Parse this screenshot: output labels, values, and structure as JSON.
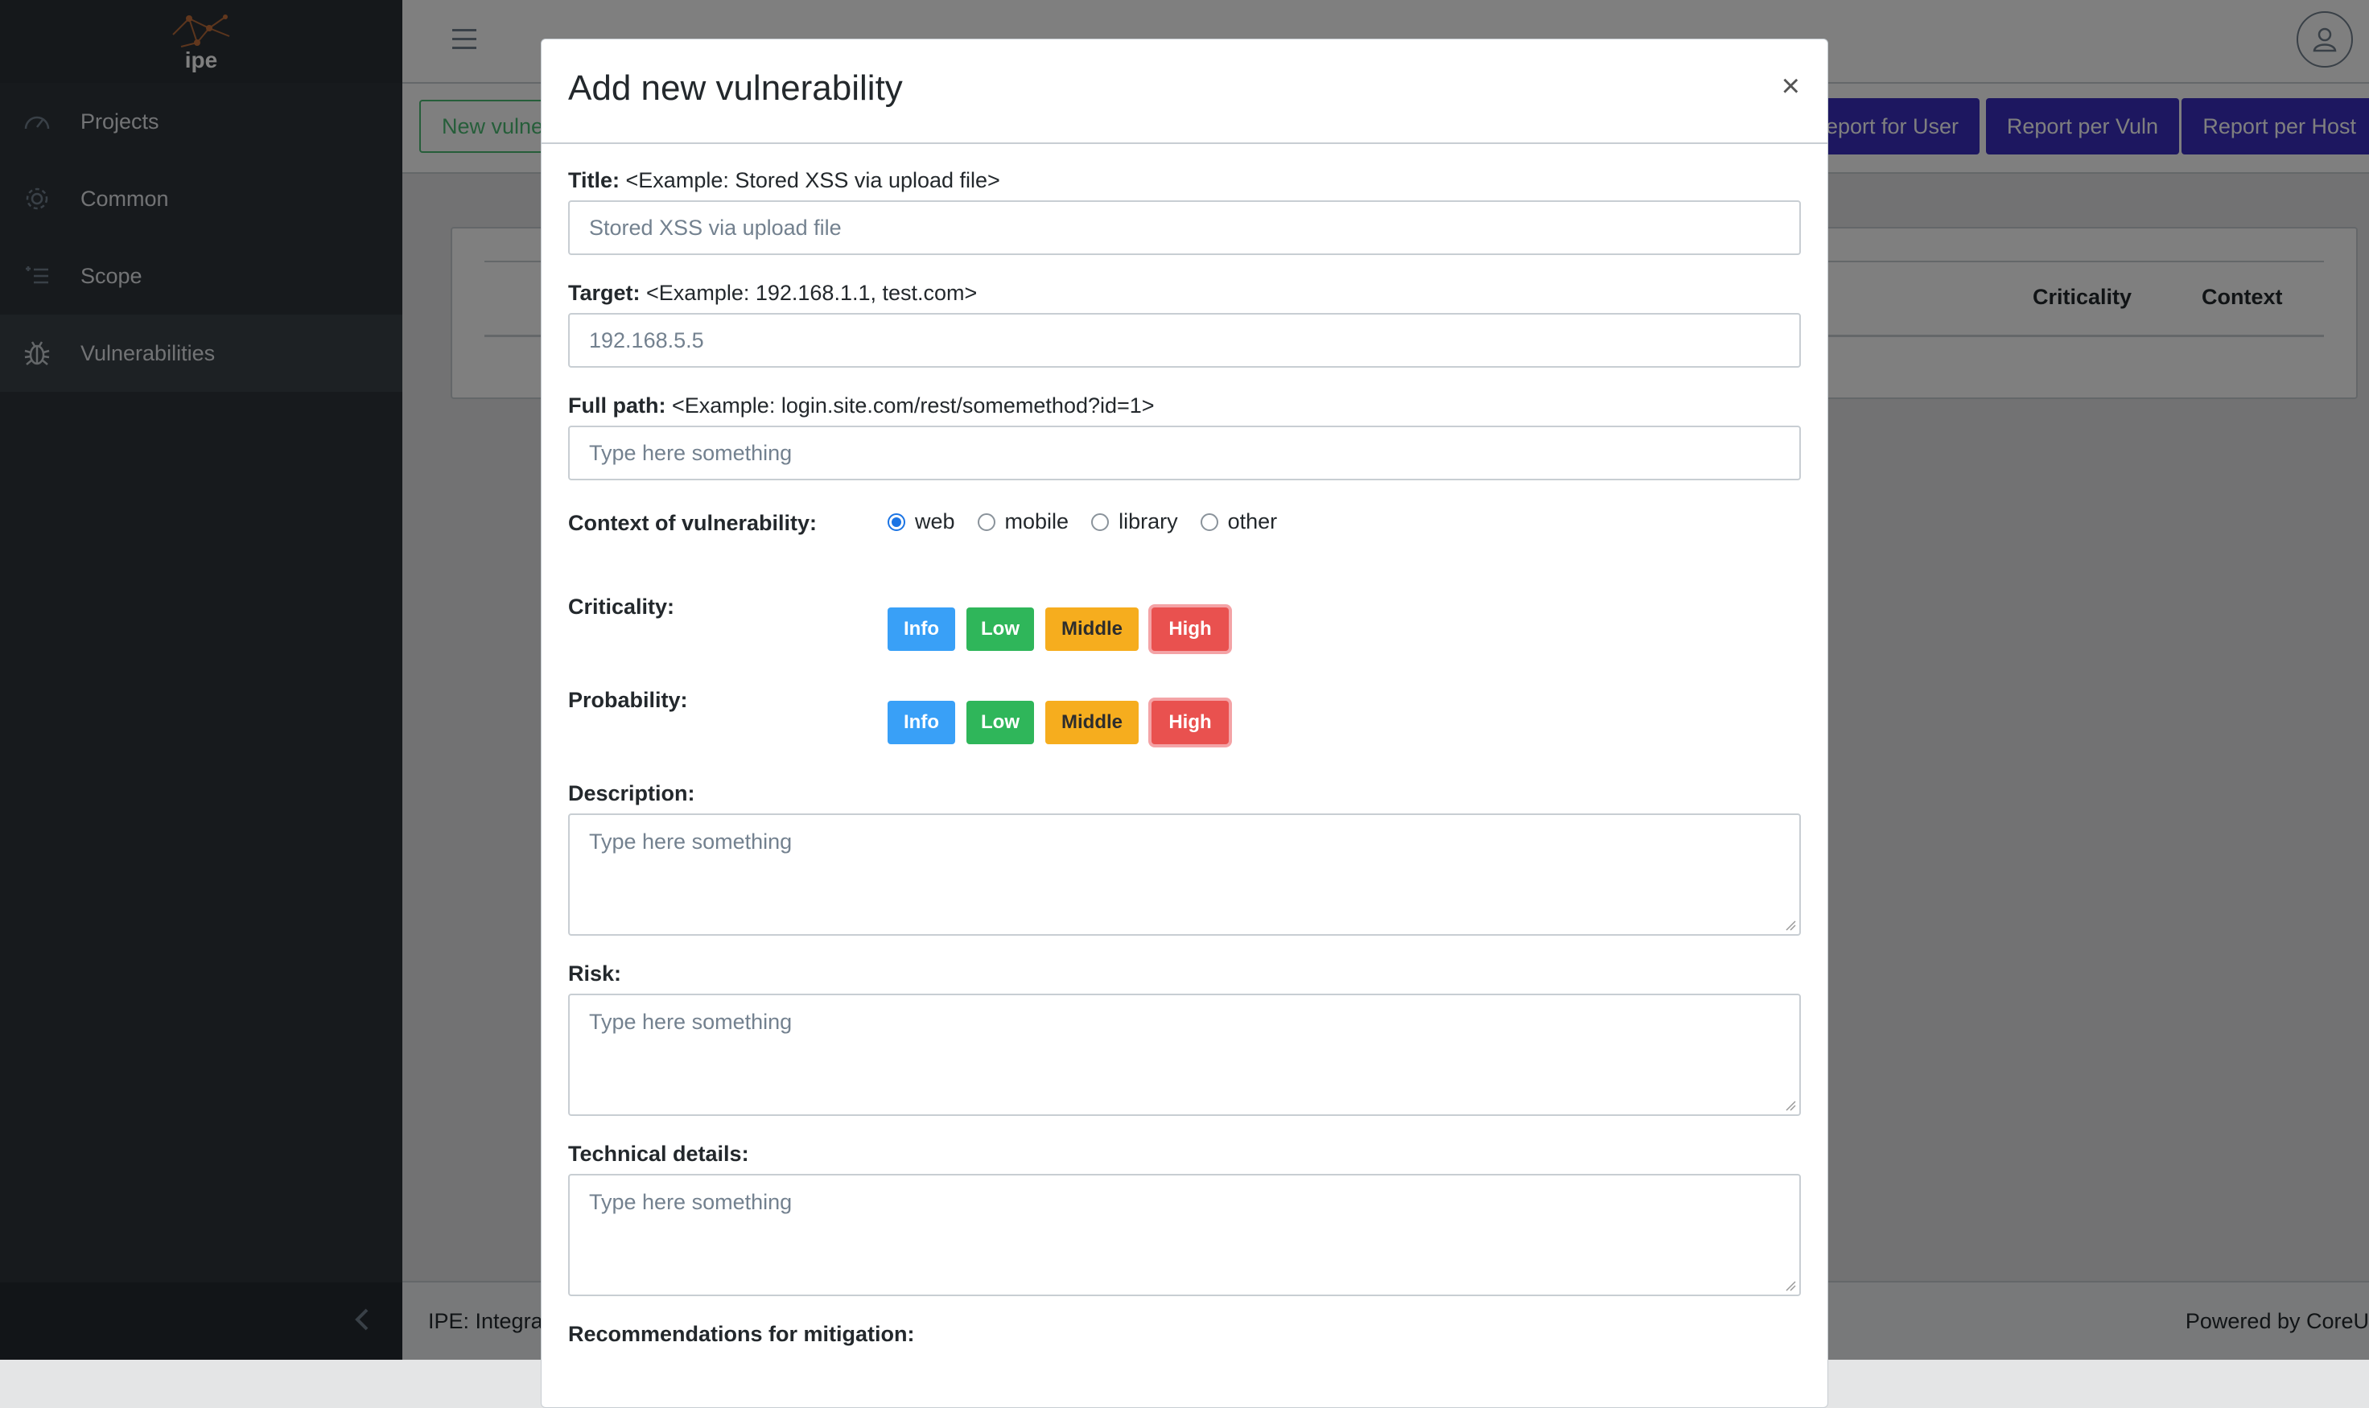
{
  "sidebar": {
    "brand": "ipe",
    "items": [
      {
        "label": "Projects",
        "icon": "speedometer-icon"
      },
      {
        "label": "Common",
        "icon": "gear-icon"
      },
      {
        "label": "Scope",
        "icon": "list-icon"
      },
      {
        "label": "Vulnerabilities",
        "icon": "bug-icon"
      }
    ]
  },
  "toolbar": {
    "new_button": "New vulne",
    "report_user": "eport for User",
    "report_vuln": "Report per Vuln",
    "report_host": "Report per Host"
  },
  "table": {
    "headers": [
      "Criticality",
      "Context"
    ]
  },
  "footer": {
    "left": "IPE: Integra",
    "right": "Powered by CoreU"
  },
  "modal": {
    "title": "Add new vulnerability",
    "close": "×",
    "fields": {
      "title": {
        "label": "Title:",
        "hint": "<Example: Stored XSS via upload file>",
        "value": "Stored XSS via upload file"
      },
      "target": {
        "label": "Target:",
        "hint": "<Example: 192.168.1.1, test.com>",
        "value": "192.168.5.5"
      },
      "full_path": {
        "label": "Full path:",
        "hint": "<Example: login.site.com/rest/somemethod?id=1>",
        "placeholder": "Type here something"
      },
      "context": {
        "label": "Context of vulnerability:",
        "options": [
          "web",
          "mobile",
          "library",
          "other"
        ],
        "selected": "web"
      },
      "criticality": {
        "label": "Criticality:",
        "options": [
          "Info",
          "Low",
          "Middle",
          "High"
        ],
        "selected": "High"
      },
      "probability": {
        "label": "Probability:",
        "options": [
          "Info",
          "Low",
          "Middle",
          "High"
        ],
        "selected": "High"
      },
      "description": {
        "label": "Description:",
        "placeholder": "Type here something"
      },
      "risk": {
        "label": "Risk:",
        "placeholder": "Type here something"
      },
      "technical": {
        "label": "Technical details:",
        "placeholder": "Type here something"
      },
      "mitigation": {
        "label": "Recommendations for mitigation:"
      }
    }
  },
  "colors": {
    "sidebar": "#2f353a",
    "accent": "#3b2ec0",
    "info": "#39a0f7",
    "low": "#2fb65a",
    "middle": "#f6ad1e",
    "high": "#e9514f"
  }
}
